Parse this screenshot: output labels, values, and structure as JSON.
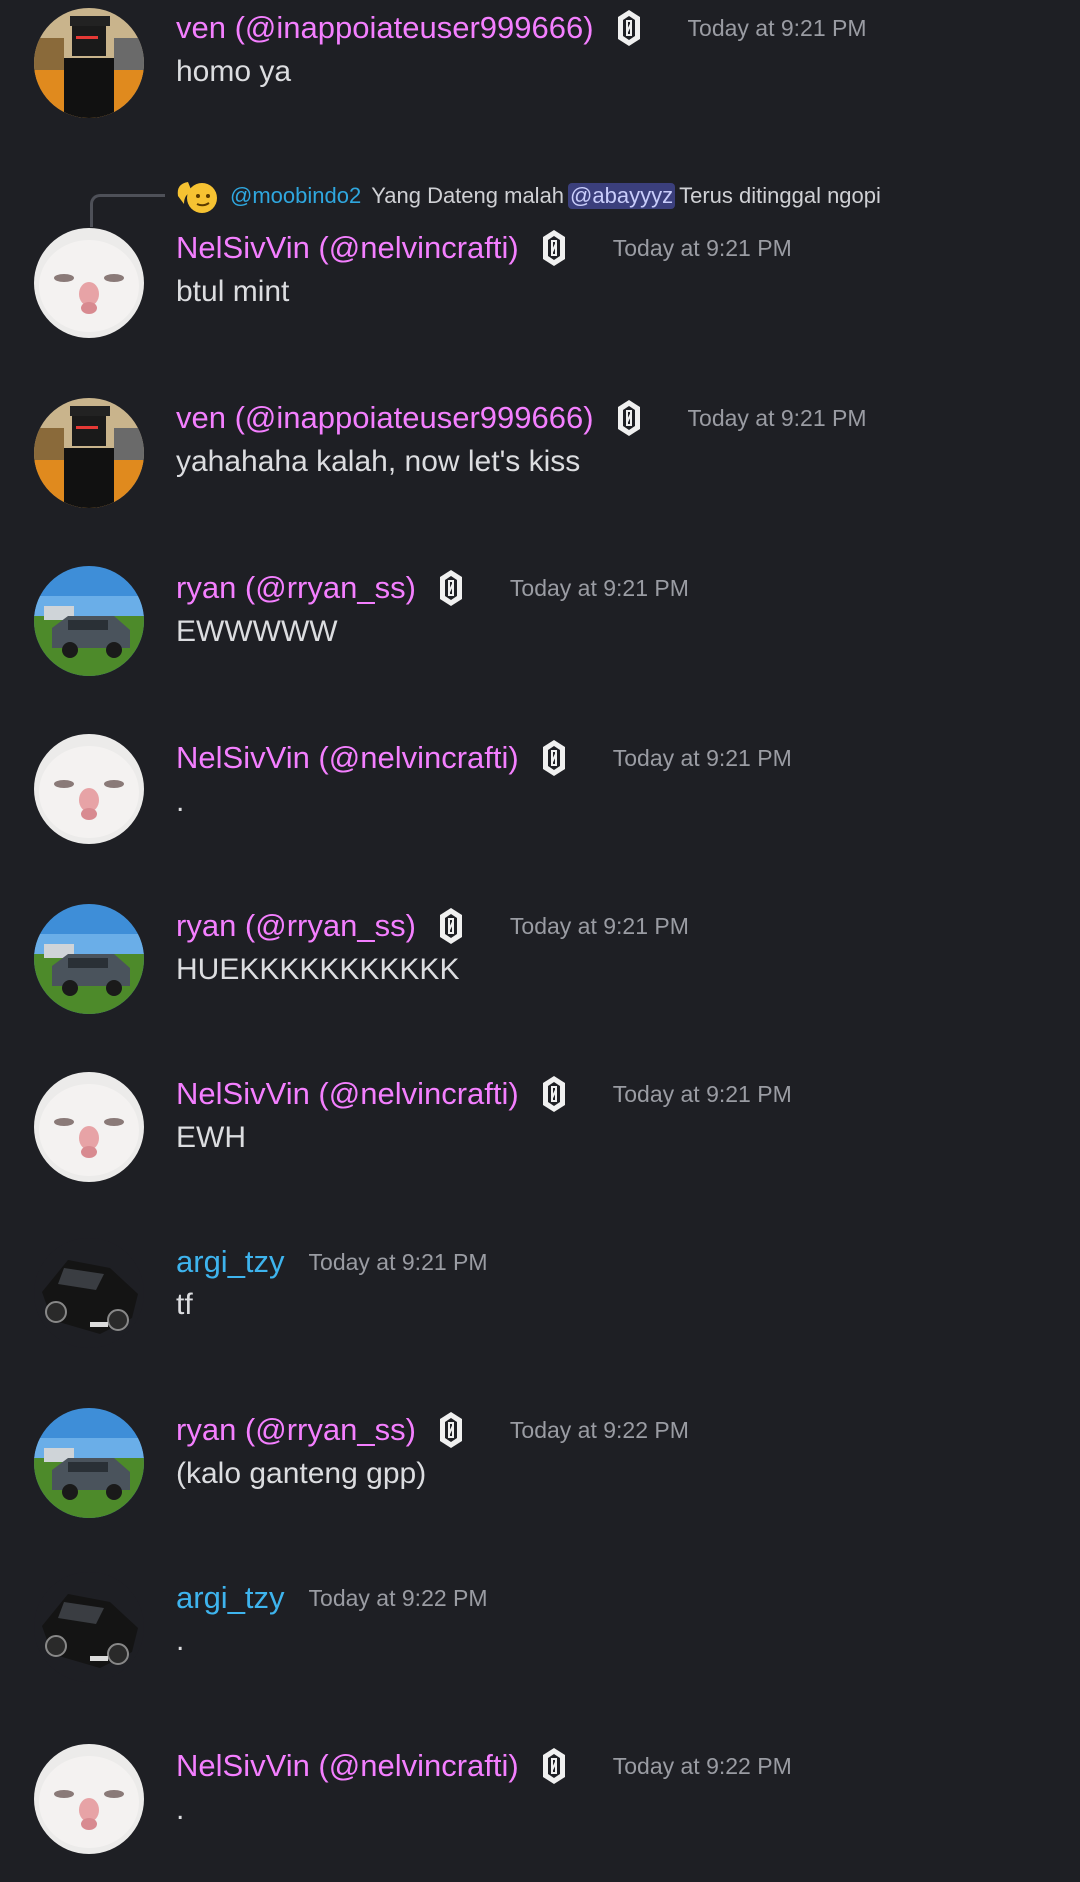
{
  "reply": {
    "username": "@moobindo2",
    "text_before": "Yang Dateng malah",
    "mention": "@abayyyz",
    "text_after": "Terus ditinggal ngopi",
    "icon": "emoji-reply-icon"
  },
  "messages": [
    {
      "author": "ven (@inappoiateuser999666)",
      "time": "Today at 9:21 PM",
      "text": "homo ya"
    },
    {
      "author": "NelSivVin (@nelvincrafti)",
      "time": "Today at 9:21 PM",
      "text": "btul mint"
    },
    {
      "author": "ven (@inappoiateuser999666)",
      "time": "Today at 9:21 PM",
      "text": "yahahaha kalah, now let's kiss"
    },
    {
      "author": "ryan (@rryan_ss)",
      "time": "Today at 9:21 PM",
      "text": "EWWWWW"
    },
    {
      "author": "NelSivVin (@nelvincrafti)",
      "time": "Today at 9:21 PM",
      "text": "."
    },
    {
      "author": "ryan (@rryan_ss)",
      "time": "Today at 9:21 PM",
      "text": "HUEKKKKKKKKKKK"
    },
    {
      "author": "NelSivVin (@nelvincrafti)",
      "time": "Today at 9:21 PM",
      "text": "EWH"
    },
    {
      "author": "argi_tzy",
      "time": "Today at 9:21 PM",
      "text": "tf"
    },
    {
      "author": "ryan (@rryan_ss)",
      "time": "Today at 9:22 PM",
      "text": "(kalo ganteng gpp)"
    },
    {
      "author": "argi_tzy",
      "time": "Today at 9:22 PM",
      "text": "."
    },
    {
      "author": "NelSivVin (@nelvincrafti)",
      "time": "Today at 9:22 PM",
      "text": "."
    }
  ],
  "colors": {
    "background": "#1e1f24",
    "name_pink": "#f47fff",
    "name_blue": "#3eb4ee",
    "timestamp": "#9a9ca3",
    "message_text": "#dcdde0",
    "mention_bg": "#3b3f7c"
  }
}
